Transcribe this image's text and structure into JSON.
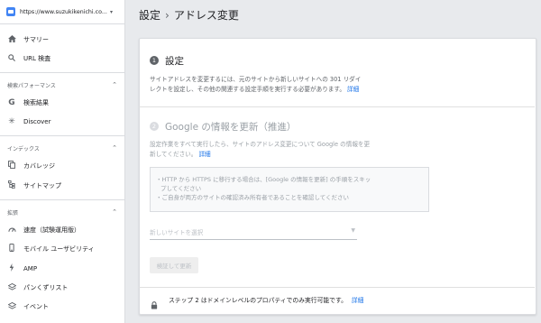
{
  "property": {
    "url": "https://www.suzukikenichi.co..."
  },
  "sidebar": {
    "summary": "サマリー",
    "url_inspection": "URL 検査",
    "performance_section": "検索パフォーマンス",
    "search_results": "検索結果",
    "discover": "Discover",
    "index_section": "インデックス",
    "coverage": "カバレッジ",
    "sitemaps": "サイトマップ",
    "enhancements_section": "拡張",
    "speed": "速度（試験運用版）",
    "mobile_usability": "モバイル ユーザビリティ",
    "amp": "AMP",
    "breadcrumbs": "パンくずリスト",
    "events": "イベント"
  },
  "header": {
    "title": "設定",
    "separator": "›",
    "subtitle": "アドレス変更"
  },
  "step1": {
    "number": "1",
    "title": "設定",
    "desc_line1": "サイトアドレスを変更するには、元のサイトから新しいサイトへの 301 リダイ",
    "desc_line2": "レクトを設定し、その他の関連する設定手順を実行する必要があります。",
    "link": "詳細"
  },
  "step2": {
    "number": "2",
    "title": "Google の情報を更新（推進）",
    "desc_line1": "設定作業をすべて実行したら、サイトのアドレス変更について Google の情報を更",
    "desc_line2": "新してください。",
    "link": "詳細",
    "notice_line1": "・HTTP から HTTPS に移行する場合は、[Google の情報を更新] の手順をスキッ",
    "notice_line2": "プしてください",
    "notice_line3": "・ご自身が両方のサイトの確認済み所有者であることを確認してください",
    "select_placeholder": "新しいサイトを選択",
    "button": "検証して更新"
  },
  "footer": {
    "text": "ステップ 2 はドメインレベルのプロパティでのみ実行可能です。",
    "link": "詳細"
  },
  "colors": {
    "accent": "#1a73e8",
    "step_active": "#5f6368",
    "step_inactive": "#dadce0"
  }
}
